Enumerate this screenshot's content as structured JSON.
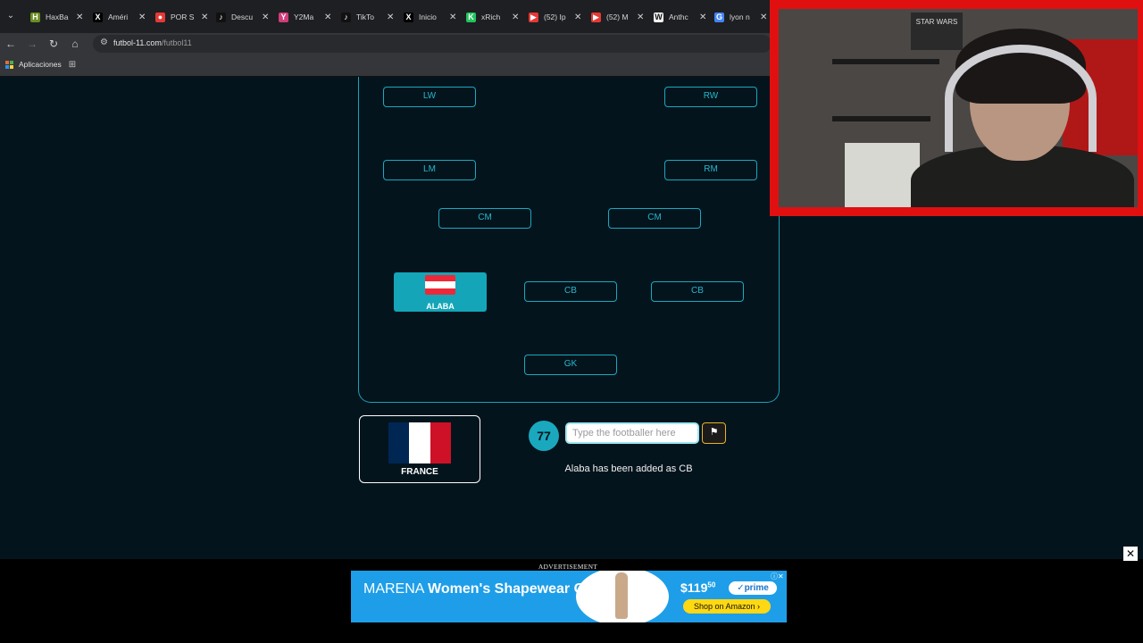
{
  "browser": {
    "tabs": [
      {
        "title": "HaxBa",
        "fav_color": "#6b8e23",
        "fav_glyph": "H"
      },
      {
        "title": "Améri",
        "fav_color": "#000000",
        "fav_glyph": "X"
      },
      {
        "title": "POR S",
        "fav_color": "#e53935",
        "fav_glyph": "●"
      },
      {
        "title": "Descu",
        "fav_color": "#111111",
        "fav_glyph": "♪"
      },
      {
        "title": "Y2Ma",
        "fav_color": "#d23c7a",
        "fav_glyph": "Y"
      },
      {
        "title": "TikTo",
        "fav_color": "#111111",
        "fav_glyph": "♪"
      },
      {
        "title": "Inicio",
        "fav_color": "#000000",
        "fav_glyph": "X"
      },
      {
        "title": "xRich",
        "fav_color": "#22c55e",
        "fav_glyph": "K"
      },
      {
        "title": "(52) Ip",
        "fav_color": "#e53935",
        "fav_glyph": "▶"
      },
      {
        "title": "(52) M",
        "fav_color": "#e53935",
        "fav_glyph": "▶"
      },
      {
        "title": "Anthc",
        "fav_color": "#f5f5f5",
        "fav_glyph": "W"
      },
      {
        "title": "lyon n",
        "fav_color": "#4285f4",
        "fav_glyph": "G"
      }
    ],
    "url_host": "futbol-11.com",
    "url_path": "/futbol11",
    "bookmark_label": "Aplicaciones"
  },
  "pitch": {
    "positions": {
      "lw": "LW",
      "rw": "RW",
      "lm": "LM",
      "rm": "RM",
      "cm_left": "CM",
      "cm_right": "CM",
      "cb_mid": "CB",
      "cb_right": "CB",
      "gk": "GK"
    },
    "filled": {
      "name": "ALABA",
      "flag_colors": [
        "#ed2939",
        "#ffffff",
        "#ed2939"
      ]
    }
  },
  "game": {
    "country": "FRANCE",
    "country_flag_colors": [
      "#002654",
      "#ffffff",
      "#ce1126"
    ],
    "counter": "77",
    "input_value": "",
    "input_placeholder": "Type the footballer here",
    "status_message": "Alaba has been added as CB"
  },
  "ad": {
    "label": "ADVERTISEMENT",
    "brand": "MARENA",
    "headline": "Women's Shapewear Girdle",
    "price_main": "$119",
    "price_cents": "50",
    "prime_label": "✓prime",
    "cta": "Shop on Amazon ›"
  },
  "webcam": {
    "poster_text": "STAR WARS"
  },
  "colors": {
    "page_bg": "#04141d",
    "accent": "#1aa8be",
    "cam_border": "#e01010"
  }
}
